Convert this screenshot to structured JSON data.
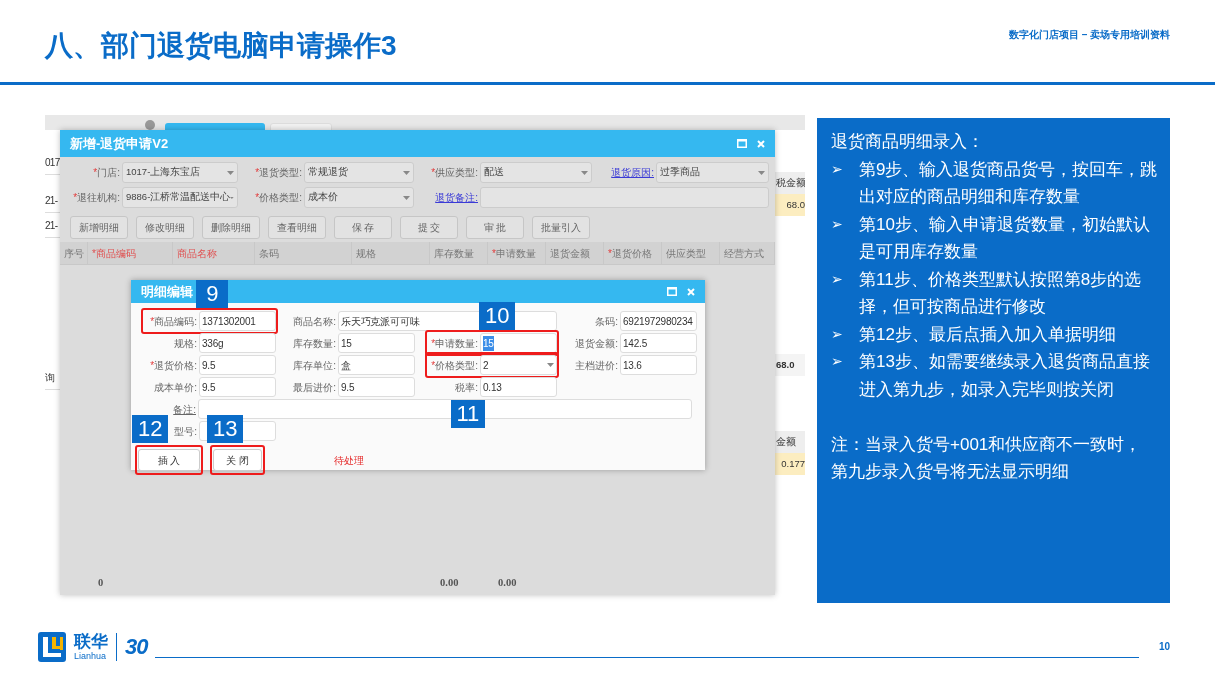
{
  "slide": {
    "title": "八、部门退货电脑申请操作3",
    "subtitle": "数字化门店项目 – 卖场专用培训资料",
    "page_number": "10",
    "logo": {
      "name": "联华",
      "latin": "Lianhua",
      "anniversary": "30"
    }
  },
  "background_window": {
    "tabs": [
      {
        "selected": true
      },
      {
        "selected": false
      }
    ],
    "left_cells": [
      "017",
      "21-",
      "21-",
      "询"
    ],
    "right_cells": [
      {
        "text": "税金额",
        "kind": "header"
      },
      {
        "text": "68.0",
        "kind": "highlight"
      },
      {
        "text": "68.0",
        "kind": "total"
      },
      {
        "text": "金额",
        "kind": "header"
      },
      {
        "text": "0.177",
        "kind": "highlight"
      }
    ]
  },
  "return_dialog": {
    "title": "新增-退货申请V2",
    "fields": [
      {
        "label": "*门店:",
        "required": true,
        "link": false,
        "kind": "select",
        "value": "1017-上海东宝店"
      },
      {
        "label": "*退货类型:",
        "required": true,
        "link": false,
        "kind": "select",
        "value": "常规退货"
      },
      {
        "label": "*供应类型:",
        "required": true,
        "link": false,
        "kind": "select",
        "value": "配送"
      },
      {
        "label": "退货原因:",
        "required": false,
        "link": true,
        "kind": "select",
        "value": "过季商品"
      },
      {
        "label": "*退往机构:",
        "required": true,
        "link": false,
        "kind": "select",
        "value": "9886-江桥常温配送中心"
      },
      {
        "label": "*价格类型:",
        "required": true,
        "link": false,
        "kind": "select",
        "value": "成本价"
      },
      {
        "label": "退货备注:",
        "required": false,
        "link": true,
        "kind": "wide"
      }
    ],
    "buttons": [
      "新增明细",
      "修改明细",
      "删除明细",
      "查看明细",
      "保 存",
      "提 交",
      "审 批",
      "批量引入"
    ],
    "columns": [
      {
        "label": "序号",
        "required": false,
        "key_field": false
      },
      {
        "label": "*商品编码",
        "required": true,
        "key_field": true,
        "total": "0"
      },
      {
        "label": "商品名称",
        "required": false,
        "key_field": true
      },
      {
        "label": "条码",
        "required": false,
        "key_field": false
      },
      {
        "label": "规格",
        "required": false,
        "key_field": false
      },
      {
        "label": "库存数量",
        "required": false,
        "key_field": false,
        "total": "0.00"
      },
      {
        "label": "*申请数量",
        "required": true,
        "key_field": false,
        "total": "0.00"
      },
      {
        "label": "退货金额",
        "required": false,
        "key_field": false
      },
      {
        "label": "*退货价格",
        "required": true,
        "key_field": false
      },
      {
        "label": "供应类型",
        "required": false,
        "key_field": false
      },
      {
        "label": "经营方式",
        "required": false,
        "key_field": false
      }
    ]
  },
  "detail_dialog": {
    "title": "明细编辑",
    "fields": [
      {
        "label": "*商品编码:",
        "required": true,
        "link": false,
        "kind": "input",
        "value": "1371302001",
        "highlighted": true,
        "callout": "9",
        "callout_below": false
      },
      {
        "label": "商品名称:",
        "required": false,
        "link": false,
        "kind": "wide",
        "value": "乐天巧克派可可味",
        "highlighted": false
      },
      {
        "label": "条码:",
        "required": false,
        "link": false,
        "kind": "input",
        "value": "6921972980234",
        "highlighted": false
      },
      {
        "label": "规格:",
        "required": false,
        "link": false,
        "kind": "input",
        "value": "336g",
        "highlighted": false
      },
      {
        "label": "库存数量:",
        "required": false,
        "link": false,
        "kind": "input",
        "value": "15",
        "highlighted": false
      },
      {
        "label": "*申请数量:",
        "required": true,
        "link": false,
        "kind": "input",
        "value": "15",
        "highlighted": true,
        "text_selected": true,
        "callout": "10",
        "callout_below": false
      },
      {
        "label": "退货金额:",
        "required": false,
        "link": false,
        "kind": "input",
        "value": "142.5",
        "highlighted": false
      },
      {
        "label": "*退货价格:",
        "required": true,
        "link": false,
        "kind": "input",
        "value": "9.5",
        "highlighted": false
      },
      {
        "label": "库存单位:",
        "required": false,
        "link": false,
        "kind": "input",
        "value": "盒",
        "highlighted": false
      },
      {
        "label": "*价格类型:",
        "required": true,
        "link": false,
        "kind": "select",
        "value": "2",
        "highlighted": true,
        "callout": "11",
        "callout_below": true
      },
      {
        "label": "主档进价:",
        "required": false,
        "link": false,
        "kind": "input",
        "value": "13.6",
        "highlighted": false
      },
      {
        "label": "成本单价:",
        "required": false,
        "link": false,
        "kind": "input",
        "value": "9.5",
        "highlighted": false
      },
      {
        "label": "最后进价:",
        "required": false,
        "link": false,
        "kind": "input",
        "value": "9.5",
        "highlighted": false
      },
      {
        "label": "税率:",
        "required": false,
        "link": false,
        "kind": "input",
        "value": "0.13",
        "highlighted": false
      },
      {
        "label": "备注:",
        "required": false,
        "link": true,
        "kind": "full",
        "highlighted": false
      },
      {
        "label": "型号:",
        "required": false,
        "link": false,
        "kind": "input",
        "highlighted": false
      }
    ],
    "buttons": [
      {
        "label": "插 入",
        "highlighted": true,
        "callout": "12"
      },
      {
        "label": "关 闭",
        "highlighted": true,
        "callout": "13"
      }
    ],
    "status": "待处理"
  },
  "instructions": {
    "heading": "退货商品明细录入：",
    "steps": [
      {
        "marker": "➢",
        "text": "第9步、输入退货商品货号，按回车，跳出对应的商品明细和库存数量"
      },
      {
        "marker": "➢",
        "text": "第10步、输入申请退货数量，初始默认是可用库存数量"
      },
      {
        "marker": "➢",
        "text": "第11步、价格类型默认按照第8步的选择，但可按商品进行修改"
      },
      {
        "marker": "➢",
        "text": "第12步、最后点插入加入单据明细"
      },
      {
        "marker": "➢",
        "text": "第13步、如需要继续录入退货商品直接进入第九步，如录入完毕则按关闭"
      }
    ],
    "note": "注：当录入货号+001和供应商不一致时，第九步录入货号将无法显示明细"
  }
}
